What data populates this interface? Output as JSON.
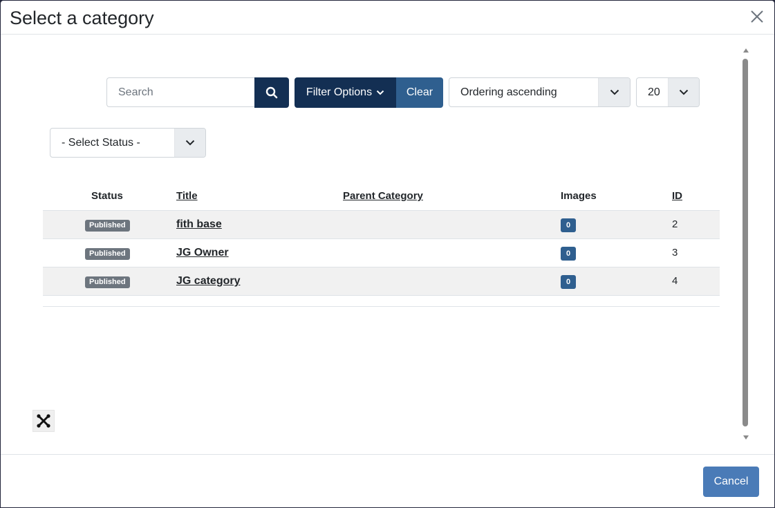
{
  "modal": {
    "title": "Select a category",
    "close_icon": "close-icon"
  },
  "filters": {
    "search_placeholder": "Search",
    "search_value": "",
    "search_icon": "search-icon",
    "filter_options_label": "Filter Options",
    "clear_label": "Clear",
    "ordering_value": "Ordering ascending",
    "limit_value": "20",
    "status_value": "- Select Status -"
  },
  "table": {
    "columns": [
      "Status",
      "Title",
      "Parent Category",
      "Images",
      "ID"
    ],
    "rows": [
      {
        "status": "Published",
        "title": "fith base",
        "parent": "",
        "images": "0",
        "id": "2"
      },
      {
        "status": "Published",
        "title": "JG Owner",
        "parent": "",
        "images": "0",
        "id": "3"
      },
      {
        "status": "Published",
        "title": "JG category",
        "parent": "",
        "images": "0",
        "id": "4"
      }
    ]
  },
  "footer": {
    "cancel_label": "Cancel"
  },
  "colors": {
    "primary_dark": "#132f53",
    "secondary_blue": "#2f5f8f",
    "cancel_blue": "#4a7bb7",
    "badge_grey": "#6d757e"
  }
}
